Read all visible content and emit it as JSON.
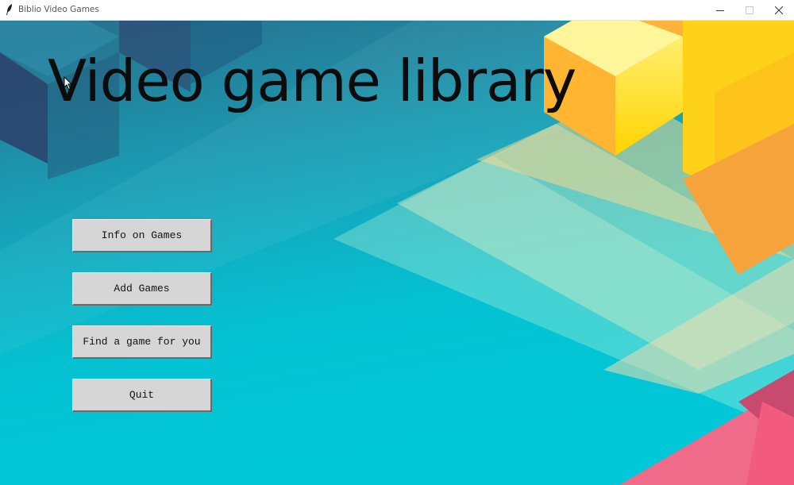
{
  "window": {
    "title": "Biblio Video Games",
    "controls": {
      "minimize_icon": "minimize-icon",
      "maximize_icon": "maximize-icon",
      "close_icon": "close-icon"
    }
  },
  "main": {
    "heading": "Video game library",
    "buttons": [
      {
        "label": "Info on Games"
      },
      {
        "label": "Add Games"
      },
      {
        "label": "Find a game for you"
      },
      {
        "label": "Quit"
      }
    ]
  },
  "colors": {
    "background_primary": "#0bbfd0",
    "button_face": "#d6d6d6",
    "heading_text": "#0c0c0c"
  }
}
